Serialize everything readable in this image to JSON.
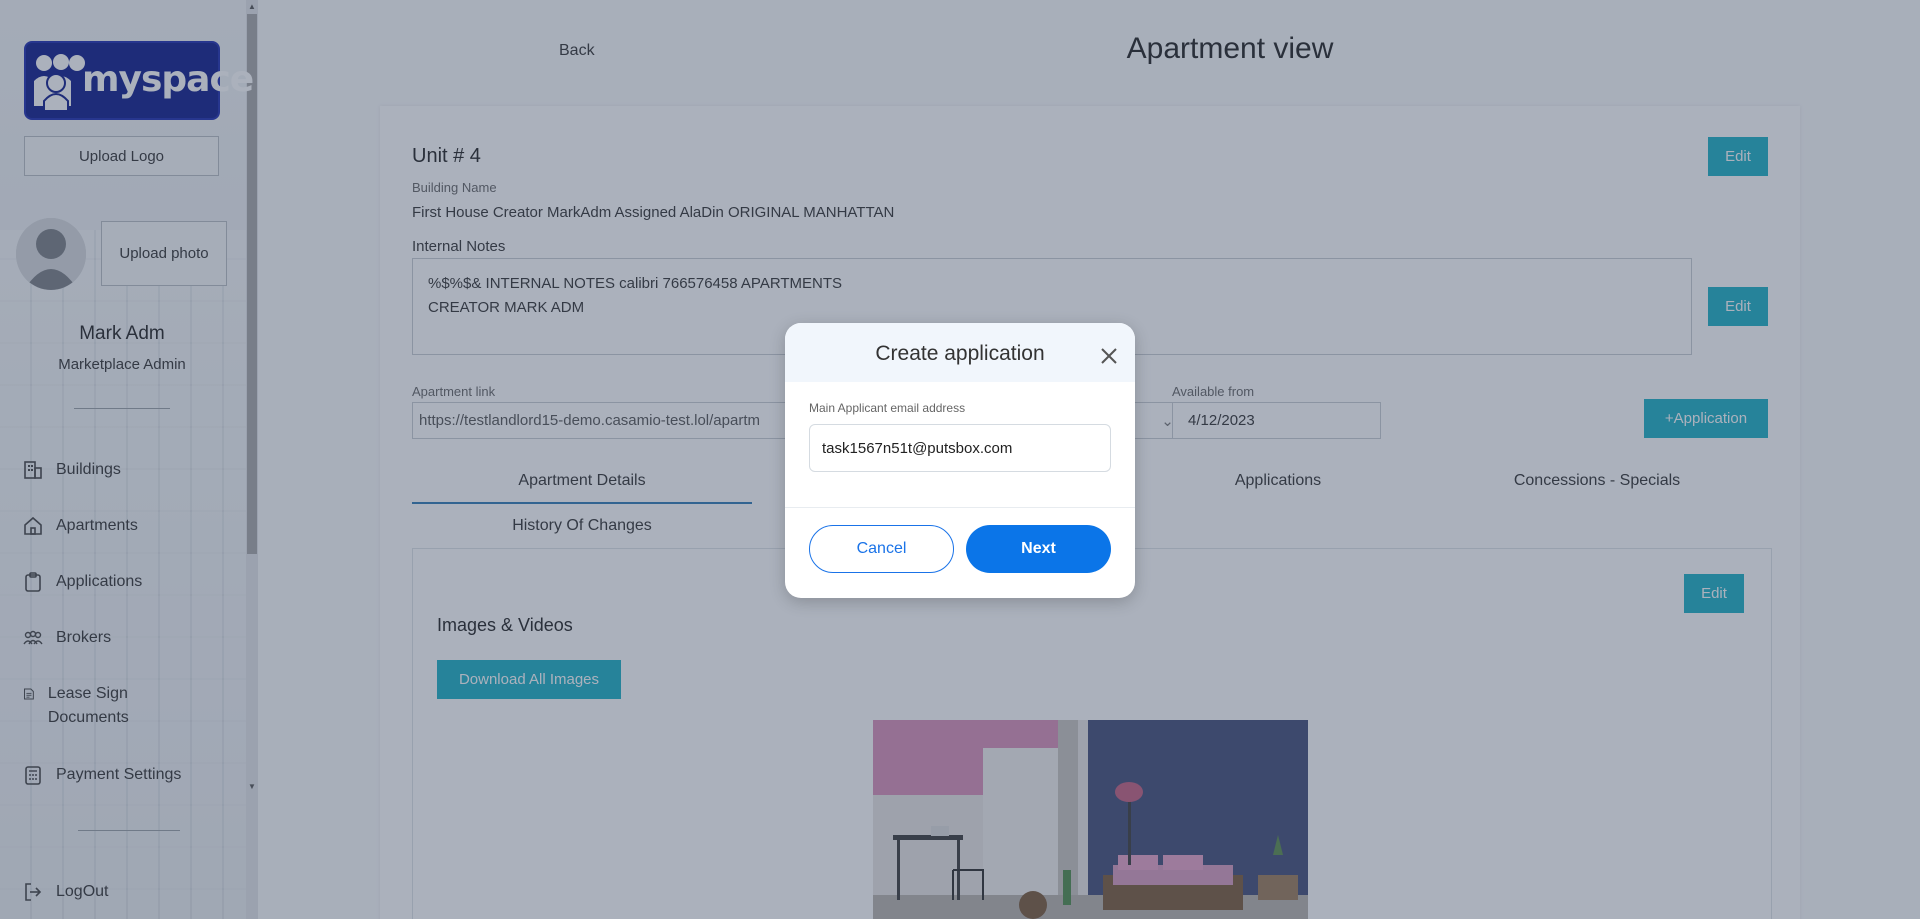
{
  "sidebar": {
    "brand": "myspace",
    "upload_logo_label": "Upload Logo",
    "upload_photo_label": "Upload photo",
    "user_name": "Mark Adm",
    "user_role": "Marketplace Admin",
    "items": [
      {
        "label": "Buildings",
        "icon": "building-icon"
      },
      {
        "label": "Apartments",
        "icon": "home-icon"
      },
      {
        "label": "Applications",
        "icon": "clipboard-icon"
      },
      {
        "label": "Brokers",
        "icon": "people-icon"
      },
      {
        "label": "Lease Sign Documents",
        "icon": "document-icon"
      },
      {
        "label": "Payment Settings",
        "icon": "calculator-icon"
      }
    ],
    "logout_label": "LogOut"
  },
  "header": {
    "back_label": "Back",
    "title": "Apartment view"
  },
  "apartment": {
    "unit_title": "Unit # 4",
    "building_name_label": "Building Name",
    "building_name": "First House Creator MarkAdm Assigned AlaDin ORIGINAL MANHATTAN",
    "internal_notes_label": "Internal Notes",
    "internal_notes_line1": "%$%$& INTERNAL NOTES calibri 766576458 APARTMENTS",
    "internal_notes_line2": "CREATOR MARK ADM",
    "apartment_link_label": "Apartment link",
    "apartment_link": "https://testlandlord15-demo.casamio-test.lol/apartm",
    "available_from_label": "Available from",
    "available_from": "4/12/2023",
    "edit_label": "Edit",
    "add_application_label": "+Application"
  },
  "tabs": [
    {
      "label": "Apartment Details",
      "active": true
    },
    {
      "label": "Applications"
    },
    {
      "label": "Concessions - Specials"
    },
    {
      "label": "History Of Changes"
    }
  ],
  "media": {
    "section_title": "Images & Videos",
    "download_label": "Download All Images"
  },
  "modal": {
    "title": "Create application",
    "email_label": "Main Applicant email address",
    "email_value": "task1567n51t@putsbox.com",
    "cancel_label": "Cancel",
    "next_label": "Next"
  },
  "colors": {
    "teal": "#1ab0c4",
    "primary": "#0b75e8",
    "brand_blue": "#0d1a8c"
  }
}
